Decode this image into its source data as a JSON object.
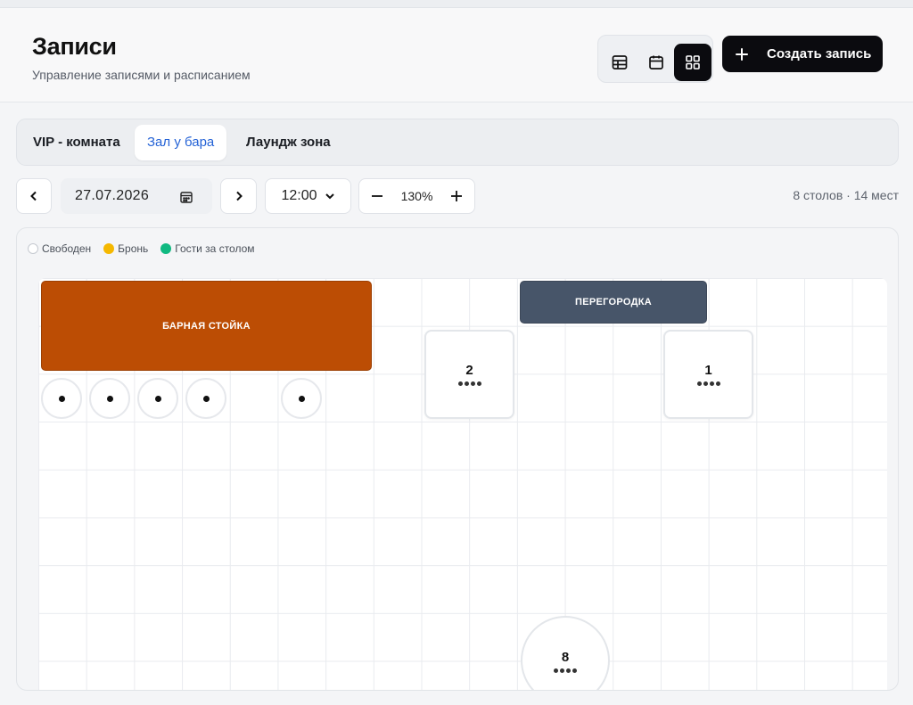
{
  "header": {
    "title": "Записи",
    "subtitle": "Управление записями и расписанием",
    "create_button": "Создать запись",
    "view_modes": [
      {
        "icon": "table-icon",
        "active": false
      },
      {
        "icon": "calendar-icon",
        "active": false
      },
      {
        "icon": "grid-icon",
        "active": true
      }
    ]
  },
  "tabs": [
    {
      "label": "VIP - комната",
      "active": false
    },
    {
      "label": "Зал у бара",
      "active": true
    },
    {
      "label": "Лаундж зона",
      "active": false
    }
  ],
  "controls": {
    "date": "27.07.2026",
    "time": "12:00",
    "zoom": "130%",
    "summary": "8 столов · 14 мест"
  },
  "legend": [
    {
      "label": "Свободен",
      "color": "#ffffff"
    },
    {
      "label": "Бронь",
      "color": "#f5b800"
    },
    {
      "label": "Гости за столом",
      "color": "#10b981"
    }
  ],
  "floor": {
    "bar_counter": "БАРНАЯ СТОЙКА",
    "partition": "ПЕРЕГОРОДКА",
    "bar_stools": 5,
    "tables": [
      {
        "number": "2",
        "seats": 4,
        "shape": "square"
      },
      {
        "number": "1",
        "seats": 4,
        "shape": "square"
      },
      {
        "number": "8",
        "seats": 4,
        "shape": "round"
      }
    ]
  },
  "colors": {
    "accent": "#2563d6",
    "bar_counter": "#bc4d04",
    "partition": "#475569",
    "primary_button": "#0b0b0f"
  }
}
